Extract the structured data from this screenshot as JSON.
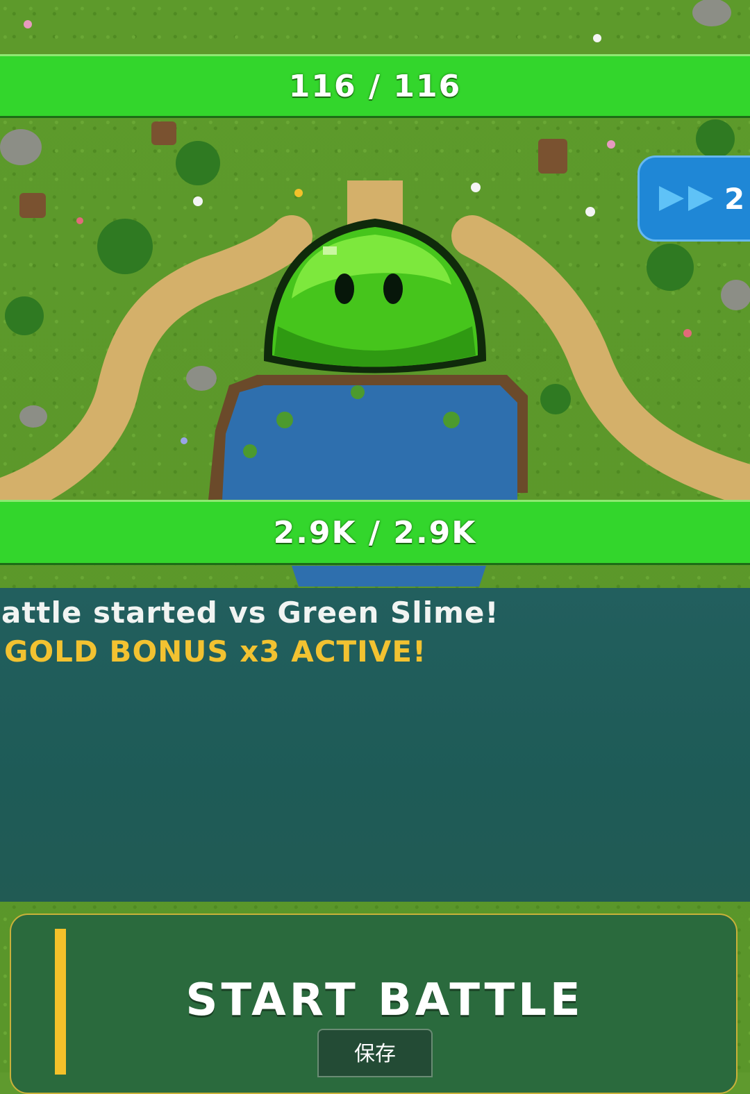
{
  "battle": {
    "player_hp_text": "116 / 116",
    "player_hp_fraction": 1.0,
    "enemy_name": "Green Slime",
    "enemy_hp_text": "2.9K / 2.9K",
    "enemy_hp_fraction": 1.0
  },
  "speed_button": {
    "icon": "fast-forward-icon",
    "label": "2"
  },
  "log": {
    "lines": [
      {
        "text": "attle started vs Green Slime!",
        "color": "#f1f4f2"
      },
      {
        "text": "GOLD BONUS x3 ACTIVE!",
        "color": "#f2c231"
      }
    ]
  },
  "actions": {
    "start_battle_label": "START BATTLE",
    "save_label": "保存"
  },
  "colors": {
    "hp_bar": "#33d62c",
    "speed_button": "#1f87d6",
    "log_panel": "#215b58",
    "battle_panel": "#2a6a3d",
    "accent": "#f3c12a"
  }
}
